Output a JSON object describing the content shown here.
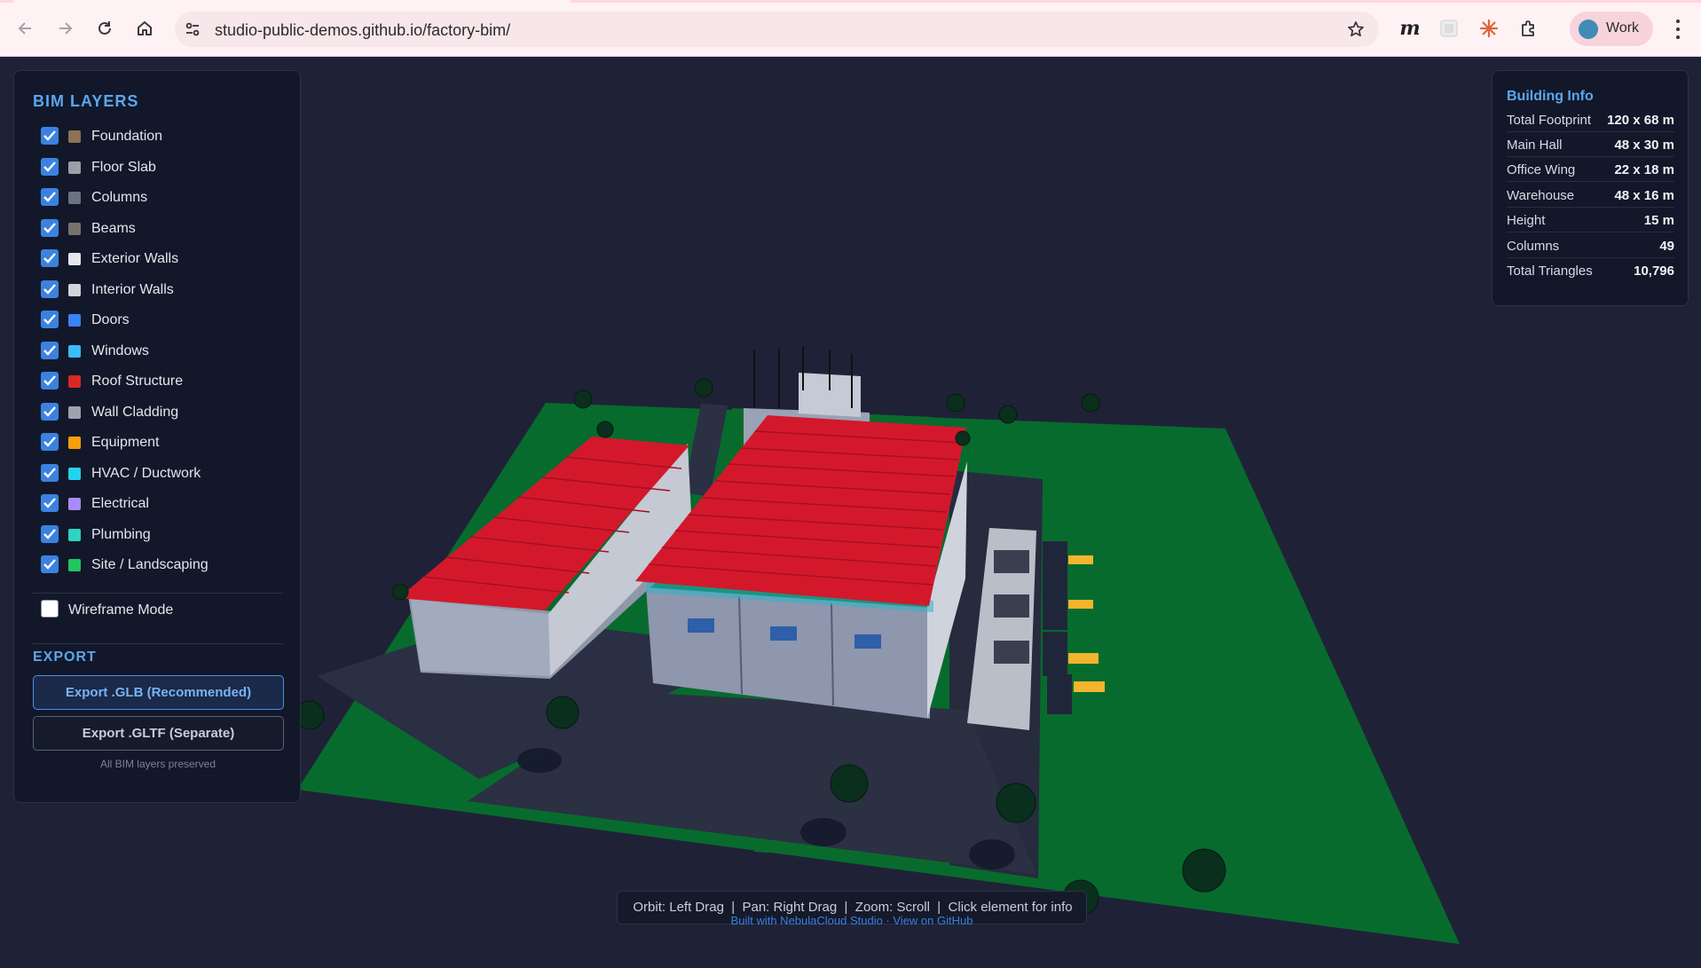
{
  "browser": {
    "url": "studio-public-demos.github.io/factory-bim/",
    "profile_label": "Work"
  },
  "layers_panel": {
    "title": "BIM LAYERS",
    "layers": [
      {
        "label": "Foundation",
        "color": "#8b7355",
        "checked": true
      },
      {
        "label": "Floor Slab",
        "color": "#9aa0aa",
        "checked": true
      },
      {
        "label": "Columns",
        "color": "#6b7280",
        "checked": true
      },
      {
        "label": "Beams",
        "color": "#78716c",
        "checked": true
      },
      {
        "label": "Exterior Walls",
        "color": "#e5e7eb",
        "checked": true
      },
      {
        "label": "Interior Walls",
        "color": "#d1d5db",
        "checked": true
      },
      {
        "label": "Doors",
        "color": "#3b82f6",
        "checked": true
      },
      {
        "label": "Windows",
        "color": "#38bdf8",
        "checked": true
      },
      {
        "label": "Roof Structure",
        "color": "#dc2626",
        "checked": true
      },
      {
        "label": "Wall Cladding",
        "color": "#9ca3af",
        "checked": true
      },
      {
        "label": "Equipment",
        "color": "#f59e0b",
        "checked": true
      },
      {
        "label": "HVAC / Ductwork",
        "color": "#22d3ee",
        "checked": true
      },
      {
        "label": "Electrical",
        "color": "#a78bfa",
        "checked": true
      },
      {
        "label": "Plumbing",
        "color": "#2dd4bf",
        "checked": true
      },
      {
        "label": "Site / Landscaping",
        "color": "#22c55e",
        "checked": true
      }
    ],
    "wireframe_label": "Wireframe Mode",
    "wireframe_checked": false,
    "export_title": "EXPORT",
    "export_glb_label": "Export .GLB (Recommended)",
    "export_gltf_label": "Export .GLTF (Separate)",
    "export_note": "All BIM layers preserved"
  },
  "building_info": {
    "title": "Building Info",
    "rows": [
      {
        "label": "Total Footprint",
        "value": "120 x 68 m"
      },
      {
        "label": "Main Hall",
        "value": "48 x 30 m"
      },
      {
        "label": "Office Wing",
        "value": "22 x 18 m"
      },
      {
        "label": "Warehouse",
        "value": "48 x 16 m"
      },
      {
        "label": "Height",
        "value": "15 m"
      },
      {
        "label": "Columns",
        "value": "49"
      },
      {
        "label": "Total Triangles",
        "value": "10,796"
      }
    ]
  },
  "hint": {
    "controls": "Orbit: Left Drag  |  Pan: Right Drag  |  Zoom: Scroll  |  Click element for info",
    "credit": "Built with NebulaCloud Studio · View on GitHub"
  }
}
